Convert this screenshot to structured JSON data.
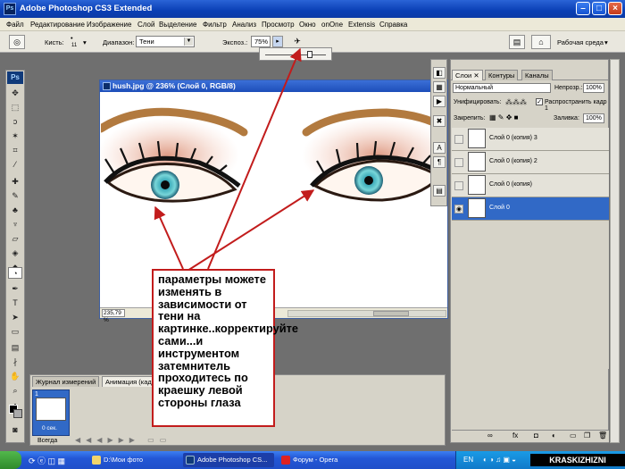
{
  "window": {
    "title": "Adobe Photoshop CS3 Extended",
    "app_icon": "Ps"
  },
  "menu": [
    "Файл",
    "Редактирование",
    "Изображение",
    "Слой",
    "Выделение",
    "Фильтр",
    "Анализ",
    "Просмотр",
    "Окно",
    "onOne",
    "Extensis",
    "Справка"
  ],
  "options": {
    "brush_label": "Кисть:",
    "brush_size": "11",
    "range_label": "Диапазон:",
    "range_value": "Тени",
    "exposure_label": "Экспоз.:",
    "exposure_value": "75%",
    "exposure_level": 0.75,
    "workspace": "Рабочая среда"
  },
  "document": {
    "title": "hush.jpg @ 236% (Слой 0, RGB/8)",
    "zoom": "235,79 %"
  },
  "layers_panel": {
    "tabs": [
      "Слои",
      "Контуры",
      "Каналы"
    ],
    "blend_mode": "Нормальный",
    "opacity_label": "Непрозр.:",
    "opacity": "100%",
    "unify_label": "Унифицировать:",
    "propagate_label": "Распространить кадр 1",
    "lock_label": "Закрепить:",
    "fill_label": "Заливка:",
    "fill": "100%",
    "layers": [
      {
        "name": "Слой 0 (копия) 3",
        "active": false
      },
      {
        "name": "Слой 0 (копия) 2",
        "active": false
      },
      {
        "name": "Слой 0 (копия)",
        "active": false
      },
      {
        "name": "Слой 0",
        "active": true
      }
    ]
  },
  "animation_panel": {
    "tabs": [
      "Журнал измерений",
      "Анимация (кадры)"
    ],
    "frame_number": "1",
    "frame_duration": "0 сек.",
    "loop": "Всегда"
  },
  "callout": {
    "text": "параметры можете изменять в зависимости от тени на картинке..корректируйте сами...и инструментом затемнитель проходитесь по краешку левой стороны глаза",
    "border_color": "#c21c1c"
  },
  "taskbar": {
    "items": [
      "D:\\Мои фото",
      "Adobe Photoshop CS...",
      "Форум - Opera"
    ],
    "lang": "EN",
    "watermark": "KRASKIZHIZNI"
  },
  "colors": {
    "title_blue": "#0a3fb5",
    "selection_blue": "#3169c6",
    "arrow_red": "#c21c1c"
  }
}
